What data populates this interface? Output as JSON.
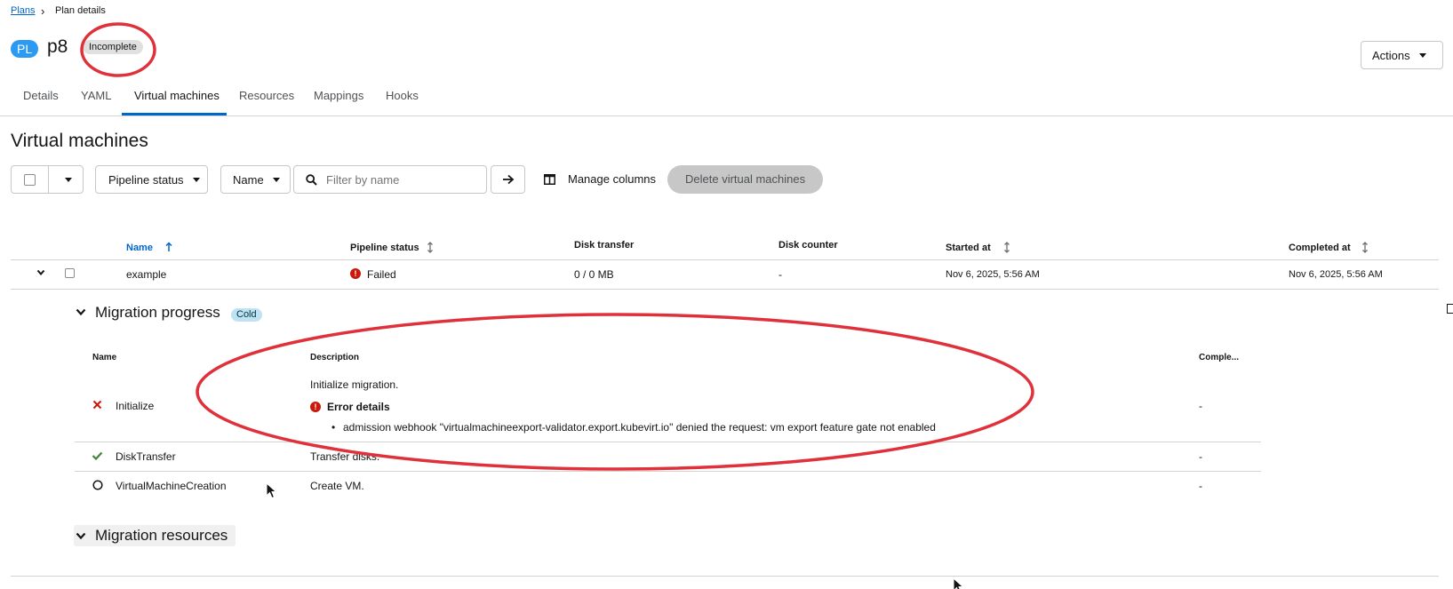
{
  "breadcrumb": {
    "root": "Plans",
    "separator": "›",
    "current": "Plan details"
  },
  "header": {
    "badge": "PL",
    "title": "p8",
    "status": "Incomplete",
    "actions_label": "Actions"
  },
  "tabs": [
    {
      "label": "Details"
    },
    {
      "label": "YAML"
    },
    {
      "label": "Virtual machines",
      "active": true
    },
    {
      "label": "Resources"
    },
    {
      "label": "Mappings"
    },
    {
      "label": "Hooks"
    }
  ],
  "section": {
    "title": "Virtual machines"
  },
  "toolbar": {
    "pipeline_filter": "Pipeline status",
    "name_filter": "Name",
    "search_placeholder": "Filter by name",
    "manage_columns": "Manage columns",
    "delete_label": "Delete virtual machines"
  },
  "table": {
    "headers": {
      "name": "Name",
      "pipeline": "Pipeline status",
      "disk_transfer": "Disk transfer",
      "disk_counter": "Disk counter",
      "started": "Started at",
      "completed": "Completed at"
    },
    "row": {
      "name": "example",
      "pipeline": "Failed",
      "disk_transfer": "0 / 0 MB",
      "disk_counter": "-",
      "started": "Nov 6, 2025, 5:56 AM",
      "completed": "Nov 6, 2025, 5:56 AM"
    }
  },
  "progress": {
    "title": "Migration progress",
    "badge": "Cold",
    "headers": {
      "name": "Name",
      "description": "Description",
      "completed": "Comple..."
    },
    "steps": [
      {
        "name": "Initialize",
        "status": "failed",
        "description": "Initialize migration.",
        "error_title": "Error details",
        "error_item": "admission webhook \"virtualmachineexport-validator.export.kubevirt.io\" denied the request: vm export feature gate not enabled",
        "completed": "-"
      },
      {
        "name": "DiskTransfer",
        "status": "succeeded",
        "description": "Transfer disks.",
        "completed": "-"
      },
      {
        "name": "VirtualMachineCreation",
        "status": "pending",
        "description": "Create VM.",
        "completed": "-"
      }
    ]
  },
  "resources": {
    "title": "Migration resources"
  },
  "annotation_color": "#e0303a",
  "colors": {
    "link": "#0066cc",
    "danger": "#c9190b",
    "success": "#3e8635",
    "badge": "#2b9af3"
  }
}
